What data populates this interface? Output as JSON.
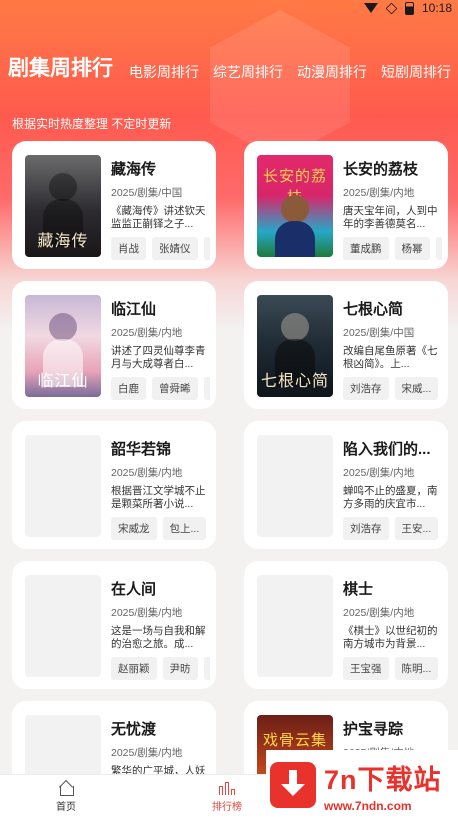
{
  "status_bar": {
    "time": "10:18"
  },
  "tabs": [
    {
      "label": "剧集周排行",
      "active": true
    },
    {
      "label": "电影周排行",
      "active": false
    },
    {
      "label": "综艺周排行",
      "active": false
    },
    {
      "label": "动漫周排行",
      "active": false
    },
    {
      "label": "短剧周排行",
      "active": false
    }
  ],
  "subtitle": "根据实时热度整理 不定时更新",
  "shows": [
    {
      "title": "藏海传",
      "meta": "2025/剧集/中国",
      "desc": "《藏海传》讲述钦天监监正蒯铎之子...",
      "actors": [
        "肖战",
        "张婧仪",
        ""
      ],
      "poster_text": "藏海传"
    },
    {
      "title": "长安的荔枝",
      "meta": "2025/剧集/内地",
      "desc": "唐天宝年间，人到中年的李善德莫名...",
      "actors": [
        "董成鹏",
        "杨幂",
        ""
      ],
      "poster_text": "长安的荔枝"
    },
    {
      "title": "临江仙",
      "meta": "2025/剧集/内地",
      "desc": "讲述了四灵仙尊李青月与大成尊者白...",
      "actors": [
        "白鹿",
        "曾舜晞",
        ""
      ],
      "poster_text": "临江仙"
    },
    {
      "title": "七根心简",
      "meta": "2025/剧集/中国",
      "desc": "改编自尾鱼原著《七根凶简》。上...",
      "actors": [
        "刘浩存",
        "宋威..."
      ],
      "poster_text": "七根心简"
    },
    {
      "title": "韶华若锦",
      "meta": "2025/剧集/内地",
      "desc": "根据晋江文学城不止是颗菜所著小说...",
      "actors": [
        "宋威龙",
        "包上..."
      ],
      "poster_text": ""
    },
    {
      "title": "陷入我们的...",
      "meta": "2025/剧集/内地",
      "desc": "蝉鸣不止的盛夏，南方多雨的庆宜市...",
      "actors": [
        "刘浩存",
        "王安..."
      ],
      "poster_text": ""
    },
    {
      "title": "在人间",
      "meta": "2025/剧集/内地",
      "desc": "这是一场与自我和解的治愈之旅。成...",
      "actors": [
        "赵丽颖",
        "尹昉",
        ""
      ],
      "poster_text": ""
    },
    {
      "title": "棋士",
      "meta": "2025/剧集/内地",
      "desc": "《棋士》以世纪初的南方城市为背景...",
      "actors": [
        "王宝强",
        "陈明..."
      ],
      "poster_text": ""
    },
    {
      "title": "无忧渡",
      "meta": "2025/剧集/内地",
      "desc": "繁华的广平城，人妖共存，妖物长隐...",
      "actors": [],
      "poster_text": ""
    },
    {
      "title": "护宝寻踪",
      "meta": "2025/剧集/内地",
      "desc": "",
      "actors": [],
      "poster_text": "戏骨云集"
    }
  ],
  "bottom_nav": {
    "home_label": "首页",
    "rank_label": "排行榜"
  },
  "watermark": {
    "title": "7n下载站",
    "url": "www.7ndn.com"
  },
  "colors": {
    "accent": "#e8453c",
    "hero_top": "#ff7a45"
  }
}
